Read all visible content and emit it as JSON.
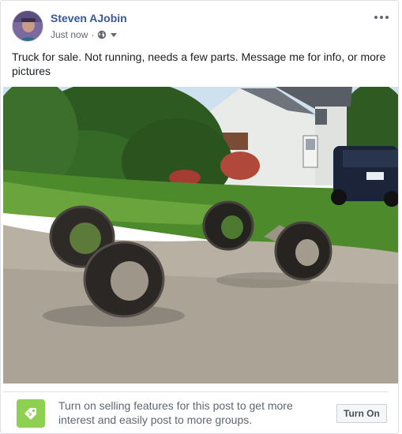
{
  "post": {
    "author_name": "Steven AJobin",
    "timestamp": "Just now",
    "separator": "·",
    "privacy_icon": "globe-icon",
    "audience_dropdown_icon": "caret-down-icon",
    "more_icon": "more-options-icon",
    "text": "Truck for sale. Not running, needs a few parts. Message me for info, or more pictures"
  },
  "photo": {
    "description_icon": "photo-tires-driveway"
  },
  "selling_prompt": {
    "icon": "price-tag-icon",
    "text": "Turn on selling features for this post to get more interest and easily post to more groups.",
    "button_label": "Turn On",
    "accent_color": "#8ed152"
  },
  "colors": {
    "name_link": "#385898",
    "secondary_text": "#606770",
    "border": "#dddfe2"
  }
}
